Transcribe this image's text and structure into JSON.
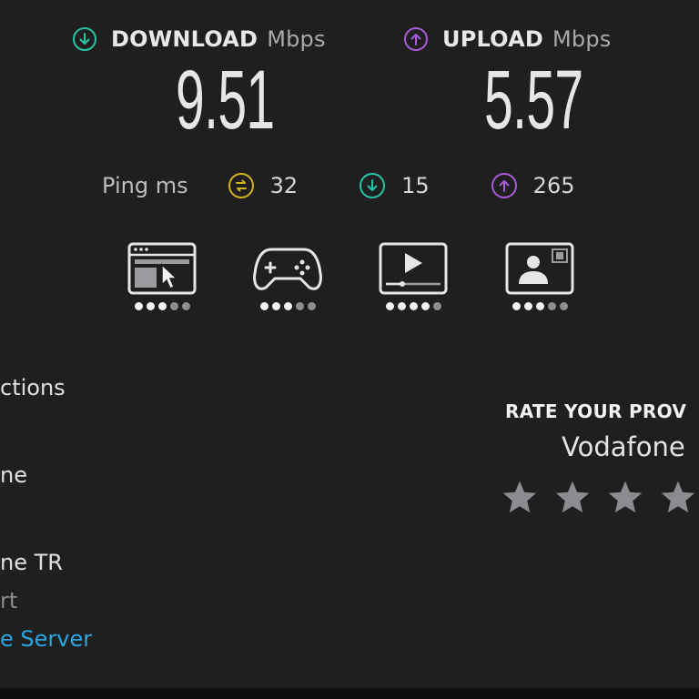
{
  "download": {
    "label": "DOWNLOAD",
    "unit": "Mbps",
    "value": "9.51",
    "color": "#27c5a6",
    "icon": "arrow-down-circle-icon"
  },
  "upload": {
    "label": "UPLOAD",
    "unit": "Mbps",
    "value": "5.57",
    "color": "#a85bd8",
    "icon": "arrow-up-circle-icon"
  },
  "ping": {
    "label": "Ping ms",
    "idle": {
      "value": "32",
      "color": "#d6b21f",
      "icon": "idle-latency-icon"
    },
    "download": {
      "value": "15",
      "color": "#27c5a6",
      "icon": "arrow-down-circle-icon"
    },
    "upload": {
      "value": "265",
      "color": "#a85bd8",
      "icon": "arrow-up-circle-icon"
    }
  },
  "experience": [
    {
      "icon": "web-browsing-icon",
      "rating": 3,
      "max": 5
    },
    {
      "icon": "gaming-controller-icon",
      "rating": 3,
      "max": 5
    },
    {
      "icon": "video-streaming-icon",
      "rating": 4,
      "max": 5
    },
    {
      "icon": "video-call-icon",
      "rating": 3,
      "max": 5
    }
  ],
  "left_panel": {
    "line1": "ctions",
    "line2": "ne",
    "line3": "ne TR",
    "line4": "rt",
    "line5": "e Server"
  },
  "rating": {
    "title": "RATE YOUR PROV",
    "provider": "Vodafone",
    "stars": 4,
    "star_color": "#8c8c90"
  }
}
